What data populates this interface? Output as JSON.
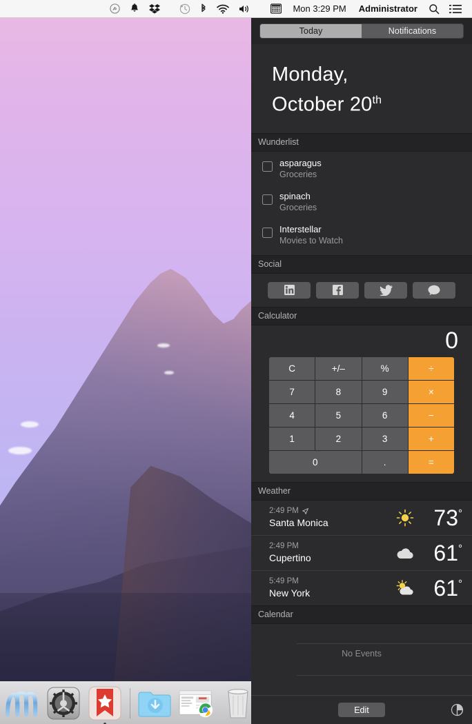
{
  "menubar": {
    "icons": [
      "shazam-icon",
      "bell-icon",
      "dropbox-icon",
      "time-machine-icon",
      "bluetooth-icon",
      "wifi-icon",
      "volume-icon",
      "input-source-icon"
    ],
    "datetime": "Mon 3:29 PM",
    "user": "Administrator",
    "search_icon": "search-icon",
    "notification_center_icon": "notification-center-icon"
  },
  "notification_center": {
    "tabs": [
      {
        "label": "Today",
        "active": true
      },
      {
        "label": "Notifications",
        "active": false
      }
    ],
    "date": {
      "line1": "Monday,",
      "line2": "October 20",
      "ordinal": "th"
    },
    "sections": [
      {
        "title": "Wunderlist",
        "items": [
          {
            "title": "asparagus",
            "list": "Groceries"
          },
          {
            "title": "spinach",
            "list": "Groceries"
          },
          {
            "title": "Interstellar",
            "list": "Movies to Watch"
          }
        ]
      },
      {
        "title": "Social",
        "buttons": [
          {
            "name": "linkedin",
            "glyph": "in"
          },
          {
            "name": "facebook",
            "glyph": "f"
          },
          {
            "name": "twitter",
            "glyph": "bird"
          },
          {
            "name": "message",
            "glyph": "bubble"
          }
        ]
      },
      {
        "title": "Calculator",
        "display": "0",
        "keys": [
          {
            "label": "C",
            "type": "fn"
          },
          {
            "label": "+/–",
            "type": "fn"
          },
          {
            "label": "%",
            "type": "fn"
          },
          {
            "label": "÷",
            "type": "op"
          },
          {
            "label": "7",
            "type": "num"
          },
          {
            "label": "8",
            "type": "num"
          },
          {
            "label": "9",
            "type": "num"
          },
          {
            "label": "×",
            "type": "op"
          },
          {
            "label": "4",
            "type": "num"
          },
          {
            "label": "5",
            "type": "num"
          },
          {
            "label": "6",
            "type": "num"
          },
          {
            "label": "−",
            "type": "op"
          },
          {
            "label": "1",
            "type": "num"
          },
          {
            "label": "2",
            "type": "num"
          },
          {
            "label": "3",
            "type": "num"
          },
          {
            "label": "+",
            "type": "op"
          },
          {
            "label": "0",
            "type": "num",
            "wide": true
          },
          {
            "label": ".",
            "type": "num"
          },
          {
            "label": "=",
            "type": "op"
          }
        ]
      },
      {
        "title": "Weather",
        "rows": [
          {
            "time": "2:49 PM",
            "city": "Santa Monica",
            "temp": "73",
            "degree": "°",
            "condition": "sunny",
            "current_location": true
          },
          {
            "time": "2:49 PM",
            "city": "Cupertino",
            "temp": "61",
            "degree": "°",
            "condition": "cloudy",
            "current_location": false
          },
          {
            "time": "5:49 PM",
            "city": "New York",
            "temp": "61",
            "degree": "°",
            "condition": "partly-cloudy",
            "current_location": false
          }
        ]
      },
      {
        "title": "Calendar",
        "empty_text": "No Events"
      }
    ],
    "footer": {
      "edit_label": "Edit",
      "settings_icon": "settings-icon"
    }
  },
  "dock": {
    "items": [
      {
        "name": "wave-app",
        "label": ""
      },
      {
        "name": "system-preferences",
        "label": ""
      },
      {
        "name": "wunderlist",
        "label": "",
        "running": true
      },
      {
        "name": "downloads-folder",
        "label": ""
      },
      {
        "name": "chrome-window-stack",
        "label": ""
      },
      {
        "name": "trash",
        "label": ""
      }
    ]
  },
  "colors": {
    "nc_background": "#2b2b2d",
    "nc_header": "#232325",
    "accent_orange": "#f5a033",
    "key_gray": "#5a5a5c",
    "tab_active": "#adadad"
  }
}
